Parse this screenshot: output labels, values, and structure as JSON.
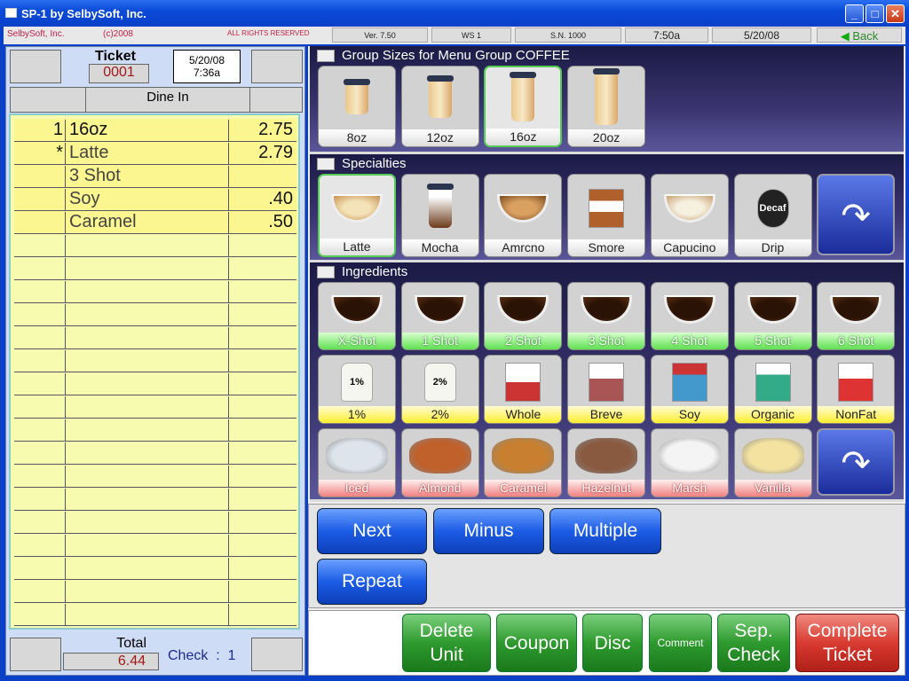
{
  "window": {
    "title": "SP-1 by SelbySoft, Inc."
  },
  "infobar": {
    "company": "SelbySoft, Inc.",
    "copyright": "(c)2008",
    "rights": "ALL RIGHTS RESERVED",
    "version": "Ver. 7.50",
    "workstation": "WS 1",
    "serial": "S.N. 1000",
    "time": "7:50a",
    "date": "5/20/08",
    "back_label": "Back"
  },
  "ticket": {
    "label": "Ticket",
    "number": "0001",
    "date": "5/20/08",
    "time": "7:36a",
    "order_type": "Dine In",
    "lines": [
      {
        "qty": "1",
        "item": "16oz",
        "price": "2.75"
      },
      {
        "qty": "*",
        "item": "Latte",
        "price": "2.79"
      },
      {
        "qty": "",
        "item": "3 Shot",
        "price": ""
      },
      {
        "qty": "",
        "item": "Soy",
        "price": ".40"
      },
      {
        "qty": "",
        "item": "Caramel",
        "price": ".50"
      }
    ],
    "total_label": "Total",
    "total": "6.44",
    "check_label": "Check  :  1"
  },
  "sizes": {
    "header": "Group Sizes for Menu Group COFFEE",
    "items": [
      {
        "label": "8oz"
      },
      {
        "label": "12oz"
      },
      {
        "label": "16oz",
        "selected": true
      },
      {
        "label": "20oz"
      }
    ]
  },
  "specialties": {
    "header": "Specialties",
    "items": [
      {
        "label": "Latte",
        "selected": true
      },
      {
        "label": "Mocha"
      },
      {
        "label": "Amrcno"
      },
      {
        "label": "Smore"
      },
      {
        "label": "Capucino"
      },
      {
        "label": "Drip"
      }
    ]
  },
  "ingredients": {
    "header": "Ingredients",
    "shots": [
      "X-Shot",
      "1 Shot",
      "2 Shot",
      "3 Shot",
      "4 Shot",
      "5 Shot",
      "6 Shot"
    ],
    "milks": [
      "1%",
      "2%",
      "Whole",
      "Breve",
      "Soy",
      "Organic",
      "NonFat"
    ],
    "flavors": [
      "Iced",
      "Almond",
      "Caramel",
      "Hazelnut",
      "Marsh",
      "Vanilla"
    ]
  },
  "actions": {
    "next": "Next",
    "minus": "Minus",
    "multiple": "Multiple",
    "repeat": "Repeat"
  },
  "bottom": {
    "delete_unit": "Delete Unit",
    "coupon": "Coupon",
    "disc": "Disc",
    "comment": "Comment",
    "sep_check": "Sep. Check",
    "complete_ticket": "Complete Ticket"
  },
  "colors": {
    "titlebar": "#0a4ad8",
    "ticket_fill": "#fcf690",
    "action_blue": "#1c5ce6",
    "bottom_green": "#2e9a2e",
    "complete_red": "#d83a30"
  }
}
